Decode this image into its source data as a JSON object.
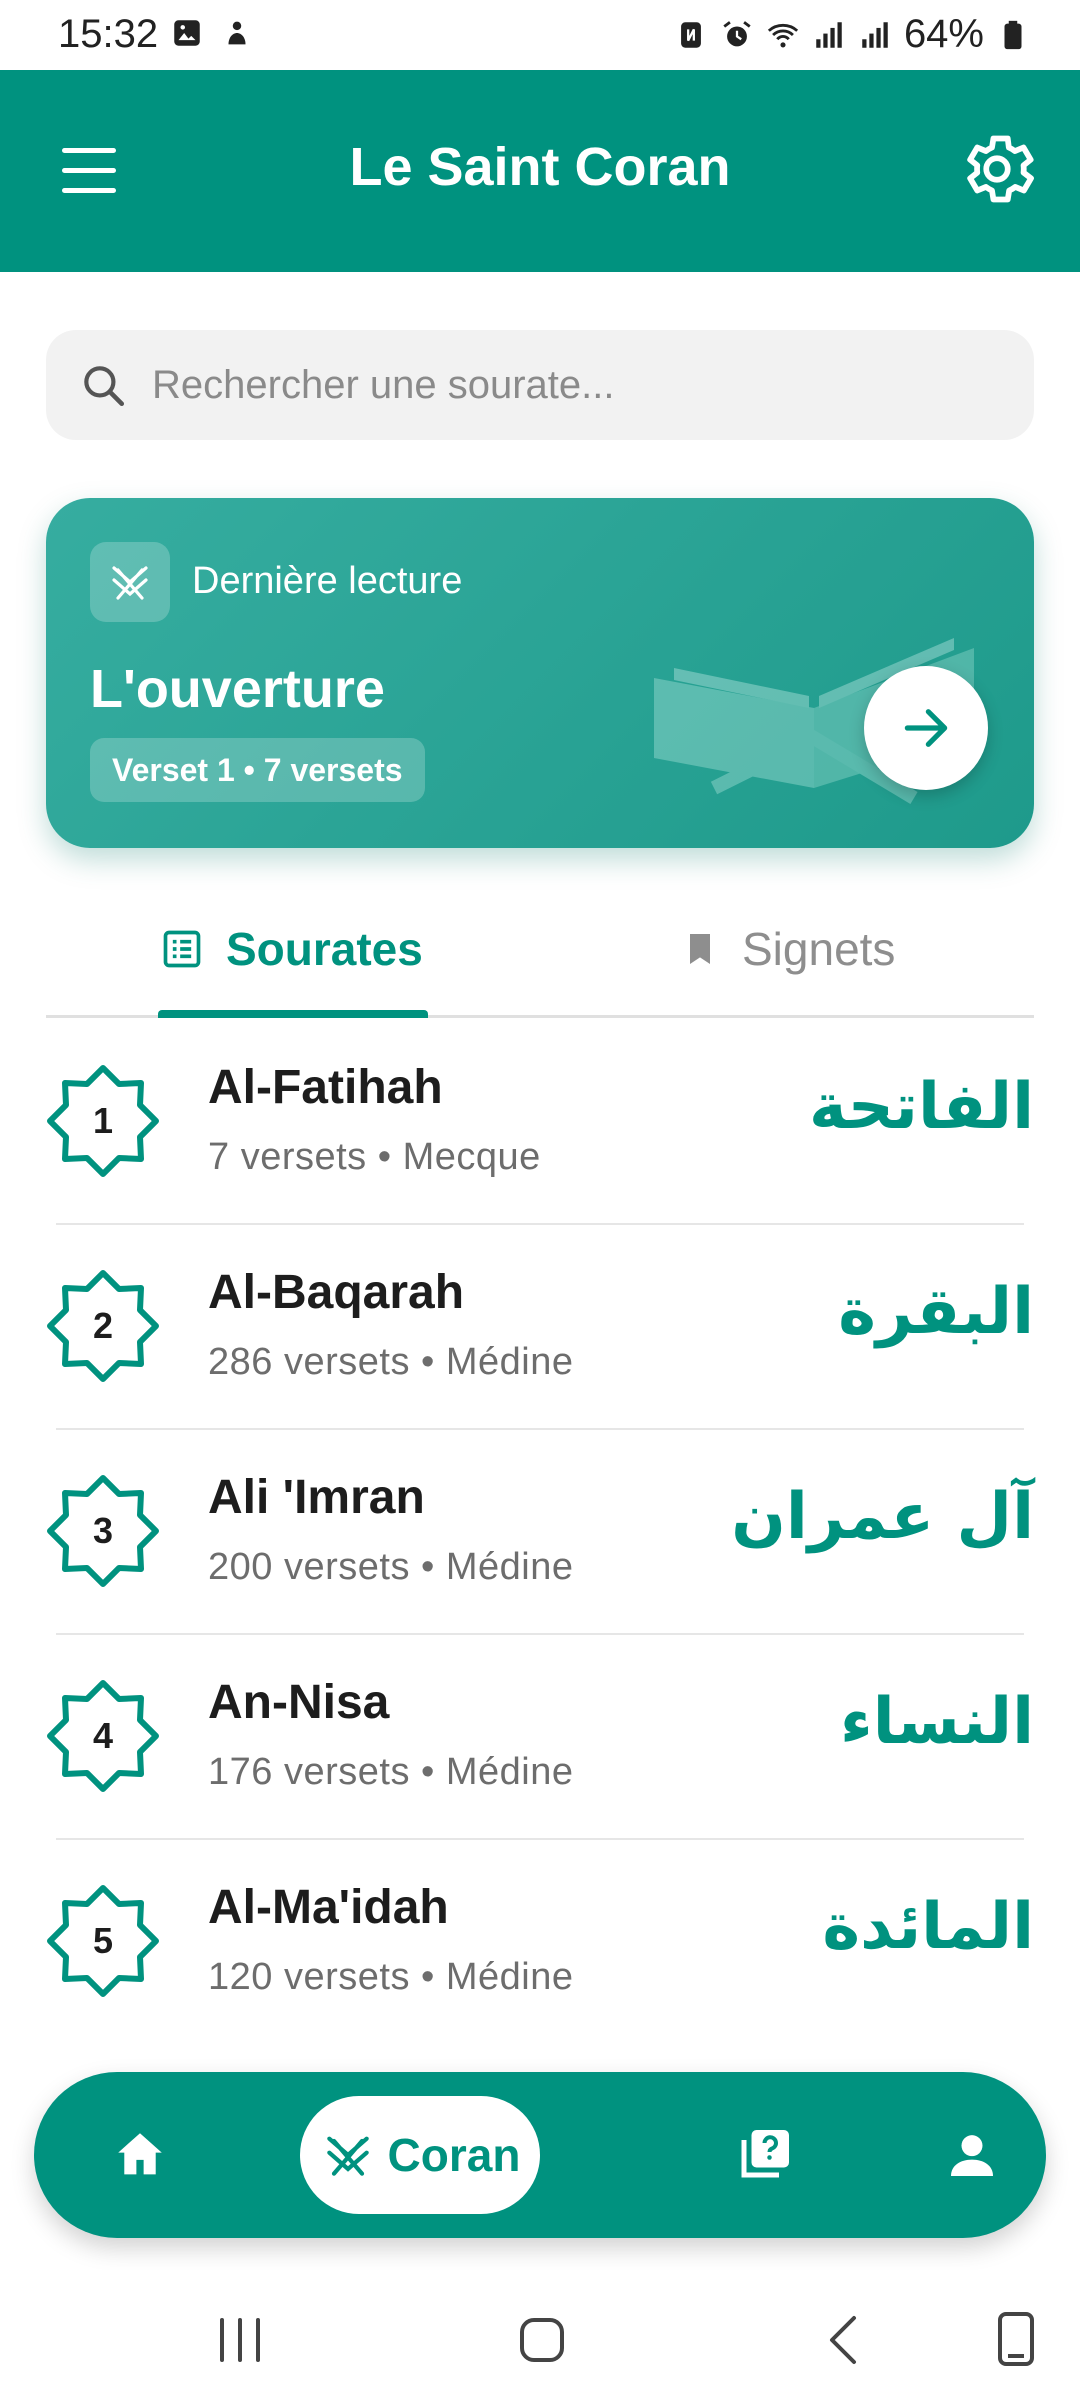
{
  "status_bar": {
    "time": "15:32",
    "battery": "64%",
    "left_icons": [
      "image-icon",
      "notification-icon"
    ],
    "right_icons": [
      "nfc-icon",
      "alarm-icon",
      "wifi-icon",
      "signal-icon",
      "signal-icon",
      "battery-icon"
    ]
  },
  "app_bar": {
    "title": "Le Saint Coran",
    "menu_icon": "menu-icon",
    "settings_icon": "gear-icon"
  },
  "search": {
    "placeholder": "Rechercher une sourate..."
  },
  "last_read": {
    "label": "Dernière lecture",
    "title": "L'ouverture",
    "progress": "Verset 1 • 7 versets"
  },
  "tabs": [
    {
      "label": "Sourates",
      "active": true
    },
    {
      "label": "Signets",
      "active": false
    }
  ],
  "surahs": [
    {
      "number": "1",
      "name": "Al-Fatihah",
      "meta": "7 versets • Mecque",
      "arabic": "الفاتحة"
    },
    {
      "number": "2",
      "name": "Al-Baqarah",
      "meta": "286 versets • Médine",
      "arabic": "البقرة"
    },
    {
      "number": "3",
      "name": "Ali 'Imran",
      "meta": "200 versets • Médine",
      "arabic": "آل عمران"
    },
    {
      "number": "4",
      "name": "An-Nisa",
      "meta": "176 versets • Médine",
      "arabic": "النساء"
    },
    {
      "number": "5",
      "name": "Al-Ma'idah",
      "meta": "120 versets • Médine",
      "arabic": "المائدة"
    }
  ],
  "bottom_nav": {
    "coran_label": "Coran",
    "active": "coran"
  },
  "colors": {
    "primary": "#00927f",
    "card": "#2ea597",
    "text_muted": "#6d6d6d"
  }
}
